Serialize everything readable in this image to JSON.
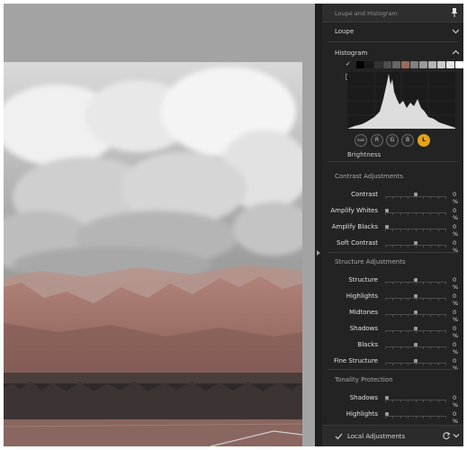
{
  "panel": {
    "title": "Loupe and Histogram",
    "loupe_label": "Loupe",
    "histogram_label": "Histogram",
    "channels": [
      {
        "label": "RGB",
        "active": false
      },
      {
        "label": "R",
        "active": false
      },
      {
        "label": "G",
        "active": false
      },
      {
        "label": "B",
        "active": false
      },
      {
        "label": "L",
        "active": true
      }
    ],
    "swatch_colors": [
      "#000000",
      "#1a1a1a",
      "#333333",
      "#4d4d4d",
      "#666666",
      "#9b6a5f",
      "#808080",
      "#999999",
      "#b3b3b3",
      "#cccccc",
      "#e6e6e6",
      "#ffffff"
    ],
    "brightness_label": "Brightness",
    "accent_color": "#e5a21a"
  },
  "contrast_group": {
    "title": "Contrast Adjustments",
    "rows": [
      {
        "label": "Contrast",
        "value": "0 %",
        "position": 0.5
      },
      {
        "label": "Amplify Whites",
        "value": "0 %",
        "position": 0.0
      },
      {
        "label": "Amplify Blacks",
        "value": "0 %",
        "position": 0.0
      },
      {
        "label": "Soft Contrast",
        "value": "0 %",
        "position": 0.5
      }
    ]
  },
  "structure_group": {
    "title": "Structure Adjustments",
    "rows": [
      {
        "label": "Structure",
        "value": "0 %",
        "position": 0.5
      },
      {
        "label": "Highlights",
        "value": "0 %",
        "position": 0.5
      },
      {
        "label": "Midtones",
        "value": "0 %",
        "position": 0.5
      },
      {
        "label": "Shadows",
        "value": "0 %",
        "position": 0.5
      },
      {
        "label": "Blacks",
        "value": "0 %",
        "position": 0.5
      },
      {
        "label": "Fine Structure",
        "value": "0 %",
        "position": 0.5
      }
    ]
  },
  "tonality_group": {
    "title": "Tonality Protection",
    "rows": [
      {
        "label": "Shadows",
        "value": "0 %",
        "position": 0.0
      },
      {
        "label": "Highlights",
        "value": "0 %",
        "position": 0.0
      }
    ]
  },
  "footer": {
    "label": "Local Adjustments"
  }
}
